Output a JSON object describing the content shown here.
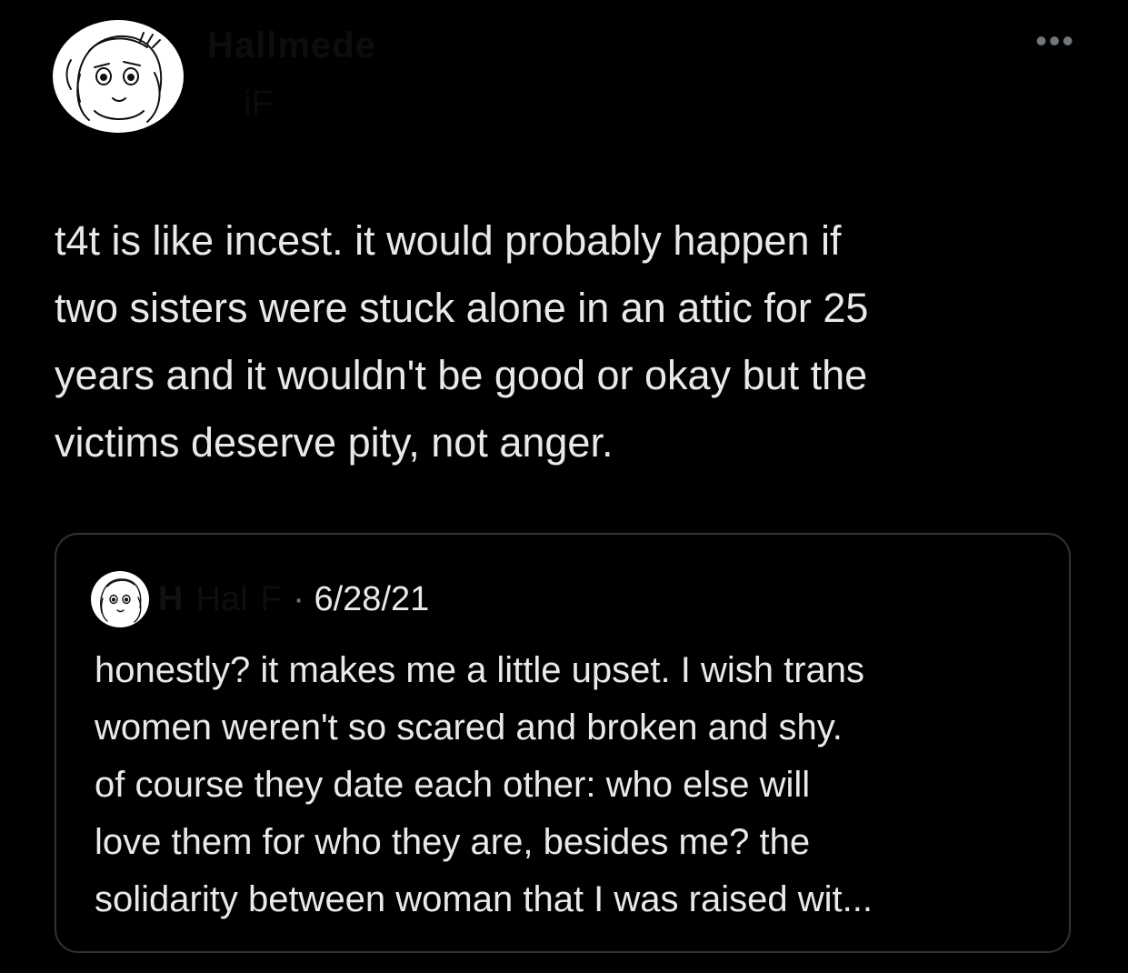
{
  "author": {
    "display_name": "Hallmede",
    "handle": "iF",
    "more_label": "•••"
  },
  "post": {
    "text": "t4t is like incest. it would probably happen if\ntwo sisters were stuck alone in an attic for 25\nyears and it wouldn't be good or okay but the\nvictims deserve pity, not anger."
  },
  "quote": {
    "display_name": "H",
    "handle": "Hal",
    "handle_suffix": "F",
    "separator": " · ",
    "date": "6/28/21",
    "text": "honestly? it makes me a little upset. I wish trans\nwomen weren't so scared and broken and shy.\nof course they date each other: who else will\nlove them for who they are, besides me? the\nsolidarity between woman that I was raised wit..."
  },
  "colors": {
    "background": "#000000",
    "text": "#e7e9ea",
    "muted": "#71767b",
    "border": "#2f3336"
  },
  "icons": {
    "avatar": "sketch-portrait-avatar",
    "more": "more-options-icon"
  }
}
